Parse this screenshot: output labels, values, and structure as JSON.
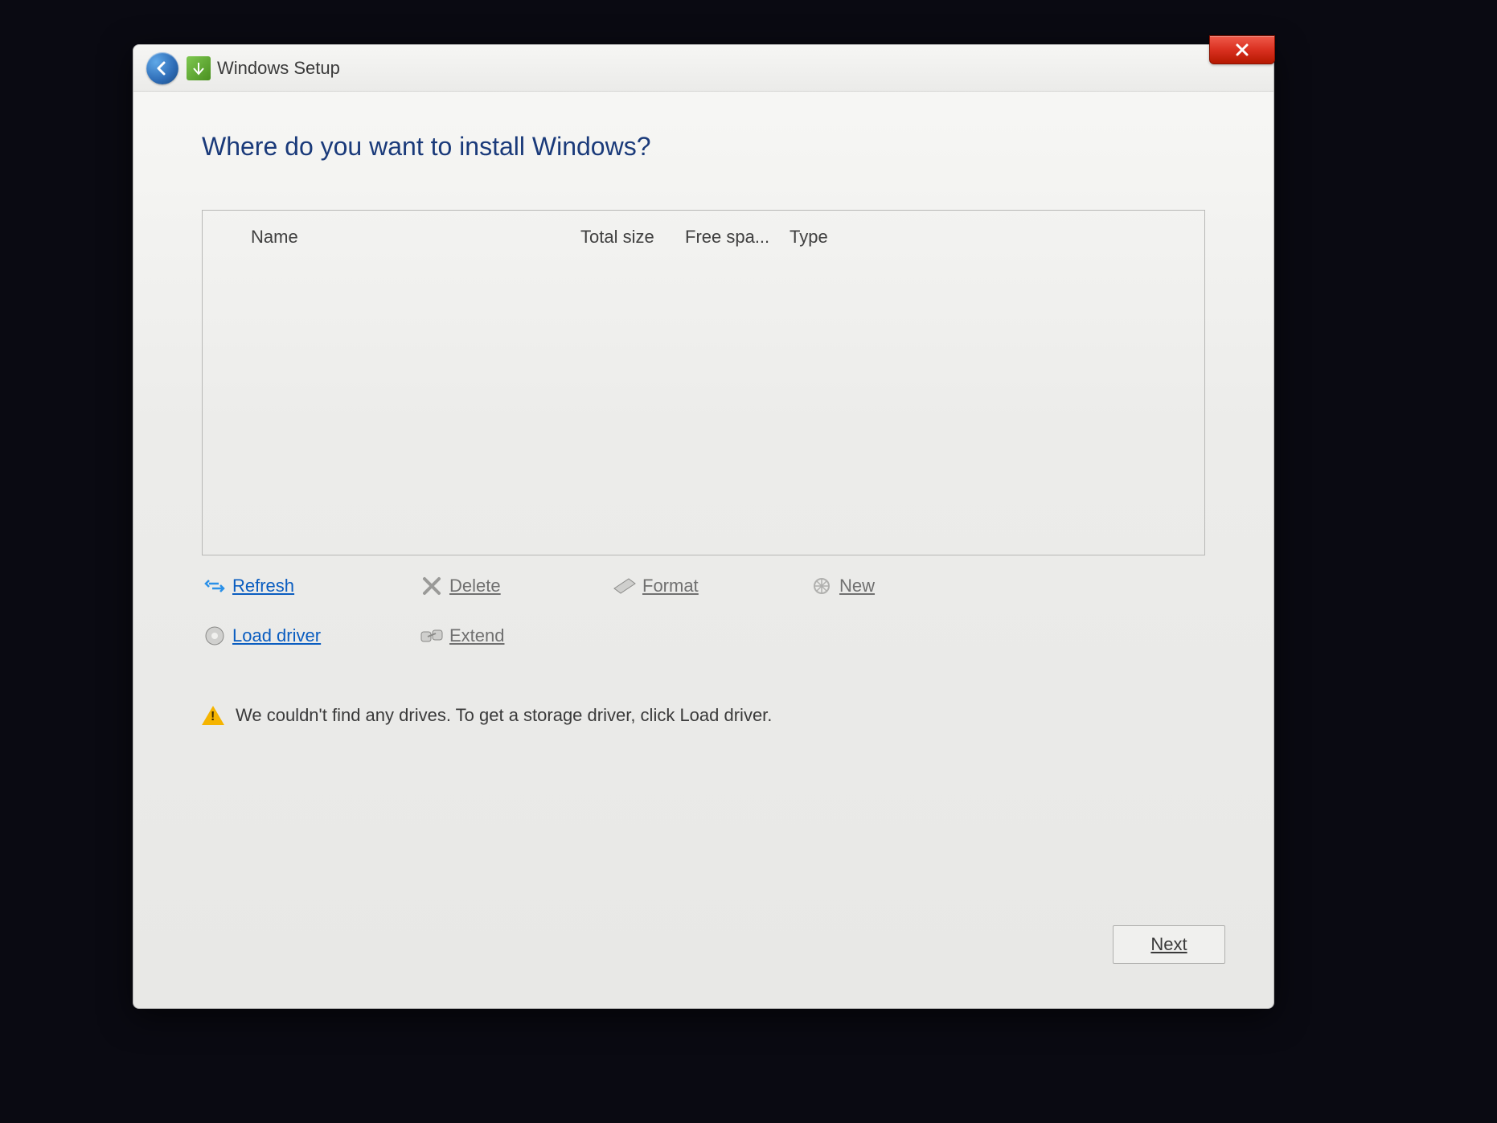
{
  "window": {
    "title": "Windows Setup"
  },
  "page": {
    "heading": "Where do you want to install Windows?"
  },
  "drive_table": {
    "columns": {
      "name": "Name",
      "total_size": "Total size",
      "free_space": "Free spa...",
      "type": "Type"
    },
    "rows": []
  },
  "actions": {
    "refresh": "Refresh",
    "delete": "Delete",
    "format": "Format",
    "new": "New",
    "load_driver": "Load driver",
    "extend": "Extend"
  },
  "status": {
    "message": "We couldn't find any drives. To get a storage driver, click Load driver."
  },
  "footer": {
    "next": "Next"
  }
}
